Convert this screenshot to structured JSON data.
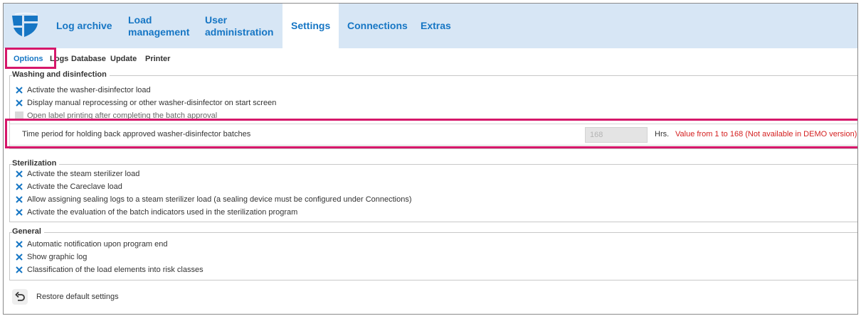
{
  "nav": {
    "items": [
      {
        "label": "Log archive",
        "active": false
      },
      {
        "label": "Load\nmanagement",
        "active": false
      },
      {
        "label": "User\nadministration",
        "active": false
      },
      {
        "label": "Settings",
        "active": true
      },
      {
        "label": "Connections",
        "active": false
      },
      {
        "label": "Extras",
        "active": false
      }
    ]
  },
  "subtabs": [
    "Options",
    "Logs",
    "Database",
    "Update",
    "Printer"
  ],
  "washing": {
    "title": "Washing and disinfection",
    "items": [
      {
        "label": "Activate the washer-disinfector load",
        "checked": true
      },
      {
        "label": "Display manual reprocessing or other washer-disinfector on start screen",
        "checked": true
      },
      {
        "label": "Open label printing after completing the batch approval",
        "checked": false,
        "disabled": true
      }
    ],
    "time_period": {
      "label": "Time period for holding back approved washer-disinfector batches",
      "value": "168",
      "unit": "Hrs.",
      "hint": "Value from 1 to 168 (Not available in DEMO version)"
    }
  },
  "sterilization": {
    "title": "Sterilization",
    "items": [
      {
        "label": "Activate the steam sterilizer load",
        "checked": true
      },
      {
        "label": "Activate the Careclave load",
        "checked": true
      },
      {
        "label": "Allow assigning sealing logs to a steam sterilizer load (a sealing device must be configured under Connections)",
        "checked": true
      },
      {
        "label": "Activate the evaluation of the batch indicators used in the sterilization program",
        "checked": true
      }
    ]
  },
  "general": {
    "title": "General",
    "items": [
      {
        "label": "Automatic notification upon program end",
        "checked": true
      },
      {
        "label": "Show graphic log",
        "checked": true
      },
      {
        "label": "Classification of the load elements into risk classes",
        "checked": true
      }
    ]
  },
  "restore_label": "Restore default settings",
  "colors": {
    "accent": "#1676c4",
    "nav_bg": "#d7e6f5",
    "highlight": "#d6176a",
    "hint_red": "#d42020"
  },
  "icons": {
    "logo": "shield-logo-icon",
    "check": "x-check-icon",
    "restore": "undo-arrow-icon"
  }
}
